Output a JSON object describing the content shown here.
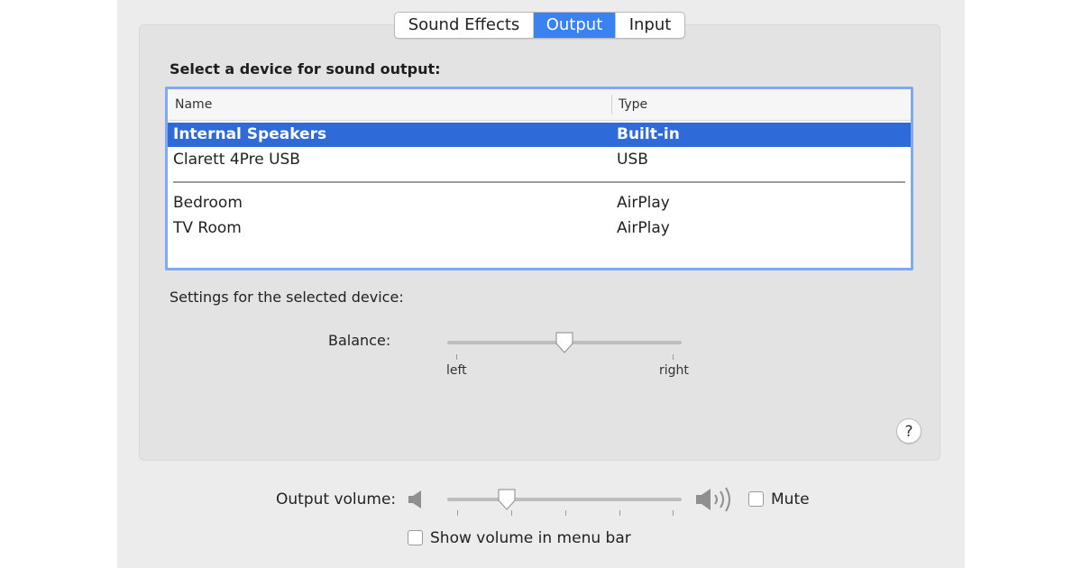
{
  "tabs": [
    {
      "label": "Sound Effects",
      "active": false
    },
    {
      "label": "Output",
      "active": true
    },
    {
      "label": "Input",
      "active": false
    }
  ],
  "output": {
    "section_title": "Select a device for sound output:",
    "columns": {
      "name": "Name",
      "type": "Type"
    },
    "devices": [
      {
        "name": "Internal Speakers",
        "type": "Built-in",
        "selected": true
      },
      {
        "name": "Clarett 4Pre USB",
        "type": "USB",
        "selected": false
      },
      {
        "name": "Bedroom",
        "type": "AirPlay",
        "selected": false
      },
      {
        "name": "TV Room",
        "type": "AirPlay",
        "selected": false
      }
    ],
    "settings_label": "Settings for the selected device:"
  },
  "balance": {
    "label": "Balance:",
    "left_label": "left",
    "right_label": "right",
    "value": 0.5
  },
  "help": {
    "label": "?"
  },
  "volume": {
    "label": "Output volume:",
    "value": 0.23,
    "mute_label": "Mute",
    "muted": false
  },
  "menubar": {
    "label": "Show volume in menu bar",
    "checked": false
  },
  "colors": {
    "accent": "#3a82f0",
    "selection": "#2e6ad8",
    "focus_ring": "#7faaf0"
  },
  "icons": {
    "speaker_low": "speaker-low-icon",
    "speaker_high": "speaker-high-icon"
  }
}
